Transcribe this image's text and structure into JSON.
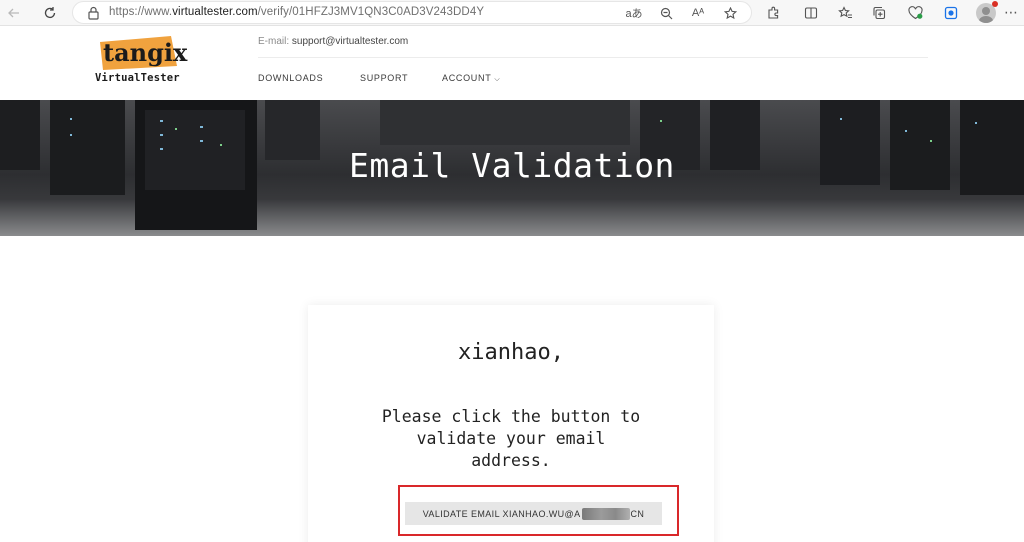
{
  "browser": {
    "url_prefix": "https://www.",
    "url_host": "virtualtester.com",
    "url_path": "/verify/01HFZJ3MV1QN3C0AD3V243DD4Y",
    "read_aloud_label": "aあ",
    "text_aloud_label": "Aᴬ"
  },
  "site": {
    "logo_word": "tangix",
    "logo_sub": "VirtualTester",
    "logo_color": "#f0a23e",
    "contact_label": "E-mail:",
    "contact_email": "support@virtualtester.com",
    "nav": {
      "downloads": "DOWNLOADS",
      "support": "SUPPORT",
      "account": "ACCOUNT"
    }
  },
  "hero": {
    "title": "Email Validation"
  },
  "card": {
    "greeting": "xianhao,",
    "message": "Please click the button to validate your email address.",
    "button_prefix": "VALIDATE EMAIL XIANHAO.WU@A",
    "button_suffix": "CN",
    "highlight_color": "#d9282a"
  }
}
